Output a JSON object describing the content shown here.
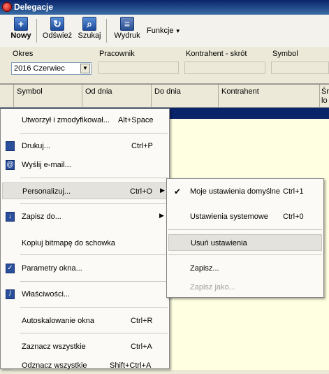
{
  "window": {
    "title": "Delegacje"
  },
  "toolbar": {
    "buttons": [
      {
        "label": "Nowy",
        "icon": "plus-icon"
      },
      {
        "label": "Odśwież",
        "icon": "refresh-icon"
      },
      {
        "label": "Szukaj",
        "icon": "search-icon"
      },
      {
        "label": "Wydruk",
        "icon": "print-icon"
      },
      {
        "label": "Funkcje",
        "icon": "chevron-down-icon"
      }
    ]
  },
  "filters": {
    "okres_label": "Okres",
    "okres_value": "2016 Czerwiec",
    "pracownik_label": "Pracownik",
    "kontrahent_label": "Kontrahent - skrót",
    "symbol_label": "Symbol"
  },
  "grid": {
    "columns": [
      "Symbol",
      "Od dnia",
      "Do dnia",
      "Kontrahent",
      "Śr",
      "lo"
    ]
  },
  "context_menu": {
    "items": [
      {
        "label": "Utworzył i zmodyfikował...",
        "shortcut": "Alt+Space"
      },
      {
        "label": "Drukuj...",
        "shortcut": "Ctrl+P"
      },
      {
        "label": "Wyślij e-mail...",
        "shortcut": ""
      },
      {
        "label": "Personalizuj...",
        "shortcut": "Ctrl+O"
      },
      {
        "label": "Zapisz do...",
        "shortcut": ""
      },
      {
        "label": "Kopiuj bitmapę do schowka",
        "shortcut": ""
      },
      {
        "label": "Parametry okna...",
        "shortcut": ""
      },
      {
        "label": "Właściwości...",
        "shortcut": ""
      },
      {
        "label": "Autoskalowanie okna",
        "shortcut": "Ctrl+R"
      },
      {
        "label": "Zaznacz wszystkie",
        "shortcut": "Ctrl+A"
      },
      {
        "label": "Odznacz wszystkie",
        "shortcut": "Shift+Ctrl+A"
      }
    ]
  },
  "submenu": {
    "items": [
      {
        "label": "Moje ustawienia domyślne",
        "shortcut": "Ctrl+1"
      },
      {
        "label": "Ustawienia systemowe",
        "shortcut": "Ctrl+0"
      },
      {
        "label": "Usuń ustawienia",
        "shortcut": ""
      },
      {
        "label": "Zapisz...",
        "shortcut": ""
      },
      {
        "label": "Zapisz jako...",
        "shortcut": ""
      }
    ]
  },
  "colors": {
    "title_bar": "#0a246a",
    "grid_background": "#ffffe1",
    "selection": "#0a246a"
  }
}
